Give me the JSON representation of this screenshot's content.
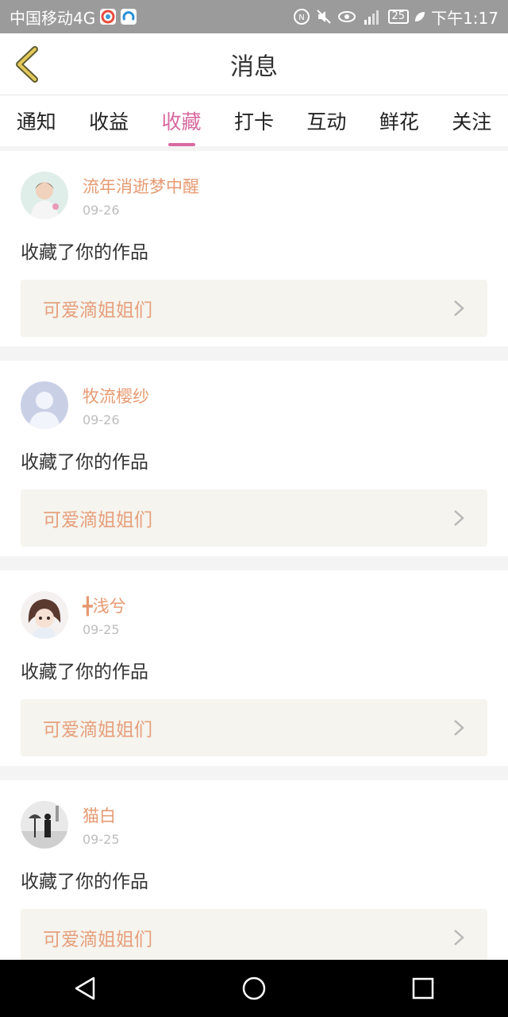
{
  "status_bar": {
    "carrier": "中国移动4G",
    "battery": "25",
    "time": "下午1:17",
    "icons": [
      "app-icon-1",
      "app-icon-2",
      "nfc-icon",
      "mute-icon",
      "eye-icon",
      "signal-icon",
      "leaf-icon"
    ]
  },
  "header": {
    "title": "消息",
    "back_icon": "back-chevron-icon"
  },
  "tabs": [
    {
      "label": "通知"
    },
    {
      "label": "收益"
    },
    {
      "label": "收藏",
      "active": true
    },
    {
      "label": "打卡"
    },
    {
      "label": "互动"
    },
    {
      "label": "鲜花"
    },
    {
      "label": "关注"
    }
  ],
  "items": [
    {
      "username": "流年消逝梦中醒",
      "date": "09-26",
      "action": "收藏了你的作品",
      "work": "可爱滴姐姐们"
    },
    {
      "username": "牧流樱纱",
      "date": "09-26",
      "action": "收藏了你的作品",
      "work": "可爱滴姐姐们"
    },
    {
      "username": "╋浅兮",
      "date": "09-25",
      "action": "收藏了你的作品",
      "work": "可爱滴姐姐们"
    },
    {
      "username": "猫白",
      "date": "09-25",
      "action": "收藏了你的作品",
      "work": "可爱滴姐姐们"
    }
  ],
  "colors": {
    "accent": "#d96aa0",
    "username": "#e69a72",
    "work_title": "#e6a07d"
  }
}
